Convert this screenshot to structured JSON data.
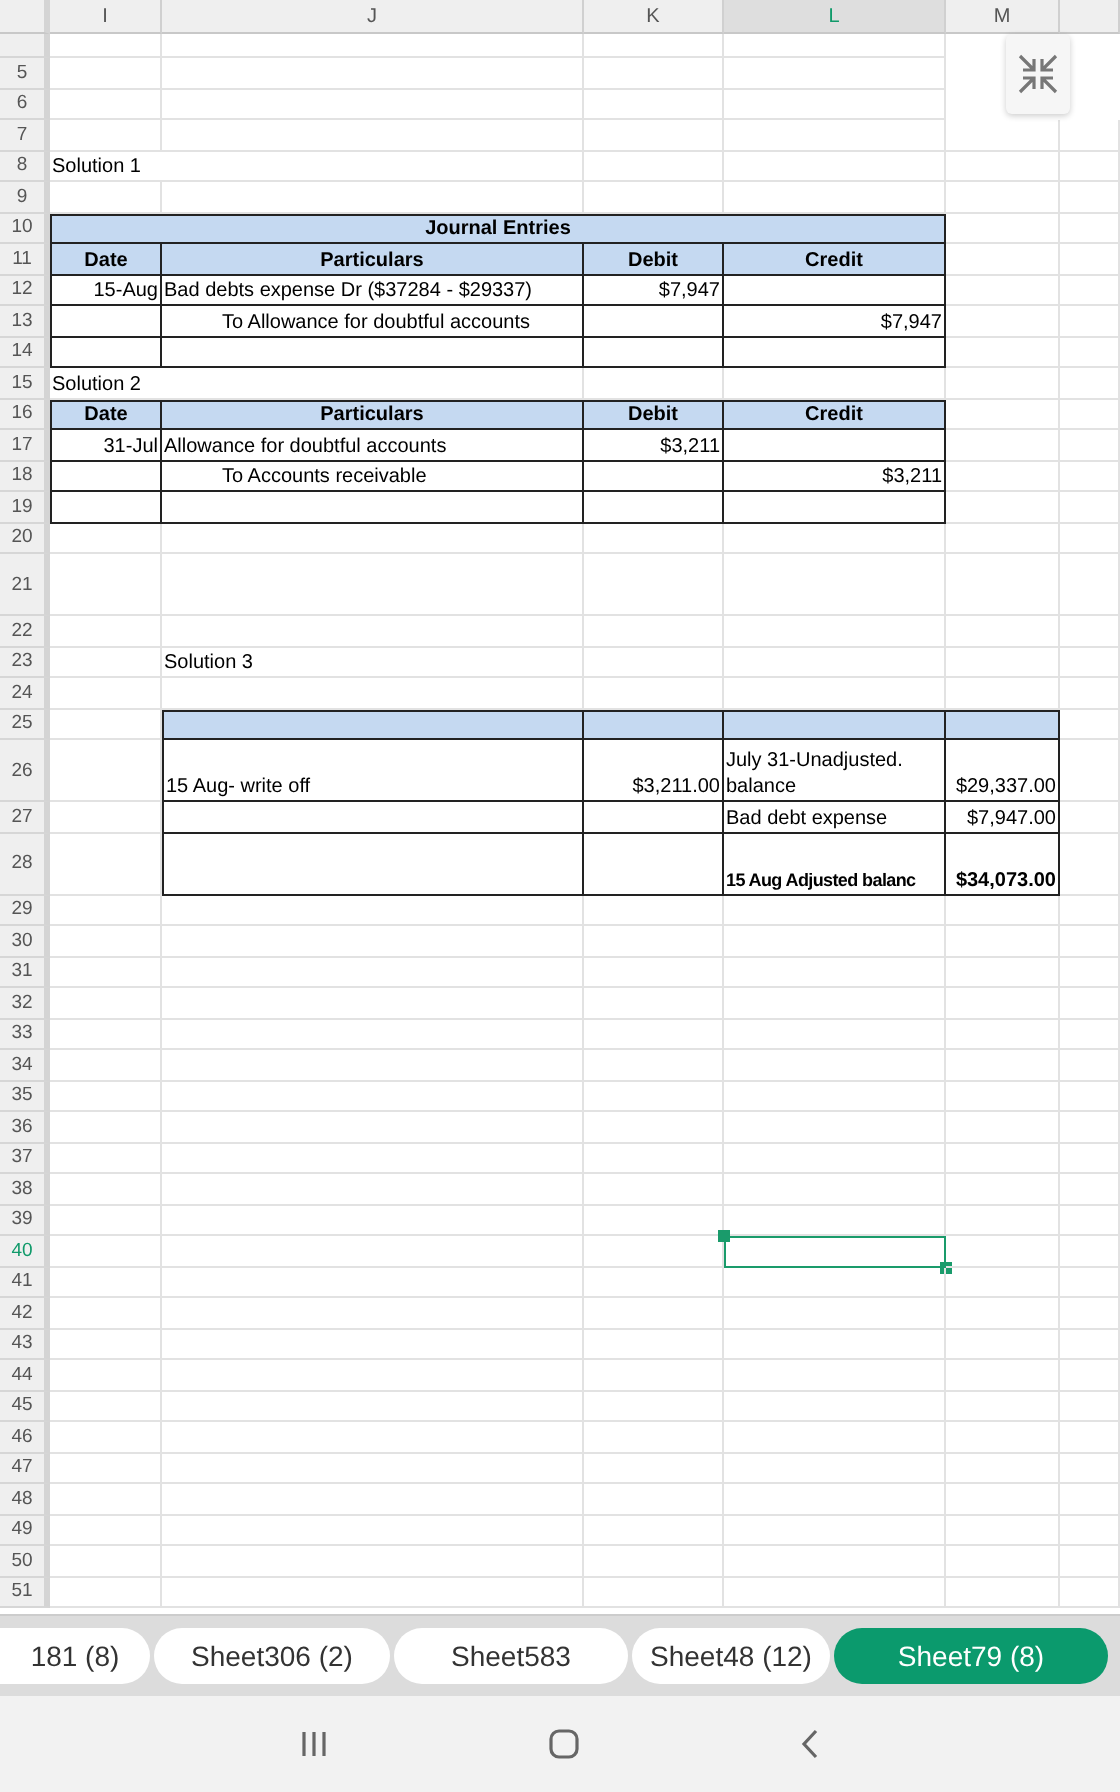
{
  "column_headers": [
    {
      "label": "I",
      "selected": false
    },
    {
      "label": "J",
      "selected": false
    },
    {
      "label": "K",
      "selected": false
    },
    {
      "label": "L",
      "selected": true
    },
    {
      "label": "M",
      "selected": false
    }
  ],
  "row_headers": [
    {
      "label": "5",
      "selected": false
    },
    {
      "label": "6",
      "selected": false
    },
    {
      "label": "7",
      "selected": false
    },
    {
      "label": "8",
      "selected": false
    },
    {
      "label": "9",
      "selected": false
    },
    {
      "label": "10",
      "selected": false
    },
    {
      "label": "11",
      "selected": false
    },
    {
      "label": "12",
      "selected": false
    },
    {
      "label": "13",
      "selected": false
    },
    {
      "label": "14",
      "selected": false
    },
    {
      "label": "15",
      "selected": false
    },
    {
      "label": "16",
      "selected": false
    },
    {
      "label": "17",
      "selected": false
    },
    {
      "label": "18",
      "selected": false
    },
    {
      "label": "19",
      "selected": false
    },
    {
      "label": "20",
      "selected": false
    },
    {
      "label": "21",
      "selected": false
    },
    {
      "label": "22",
      "selected": false
    },
    {
      "label": "23",
      "selected": false
    },
    {
      "label": "24",
      "selected": false
    },
    {
      "label": "25",
      "selected": false
    },
    {
      "label": "26",
      "selected": false
    },
    {
      "label": "27",
      "selected": false
    },
    {
      "label": "28",
      "selected": false
    },
    {
      "label": "29",
      "selected": false
    },
    {
      "label": "30",
      "selected": false
    },
    {
      "label": "31",
      "selected": false
    },
    {
      "label": "32",
      "selected": false
    },
    {
      "label": "33",
      "selected": false
    },
    {
      "label": "34",
      "selected": false
    },
    {
      "label": "35",
      "selected": false
    },
    {
      "label": "36",
      "selected": false
    },
    {
      "label": "37",
      "selected": false
    },
    {
      "label": "38",
      "selected": false
    },
    {
      "label": "39",
      "selected": false
    },
    {
      "label": "40",
      "selected": true
    },
    {
      "label": "41",
      "selected": false
    },
    {
      "label": "42",
      "selected": false
    },
    {
      "label": "43",
      "selected": false
    },
    {
      "label": "44",
      "selected": false
    },
    {
      "label": "45",
      "selected": false
    },
    {
      "label": "46",
      "selected": false
    },
    {
      "label": "47",
      "selected": false
    },
    {
      "label": "48",
      "selected": false
    },
    {
      "label": "49",
      "selected": false
    },
    {
      "label": "50",
      "selected": false
    },
    {
      "label": "51",
      "selected": false
    }
  ],
  "solution_1": "Solution 1",
  "journal_1": {
    "title": "Journal Entries",
    "headers": [
      "Date",
      "Particulars",
      "Debit",
      "Credit"
    ],
    "entries": [
      {
        "date": "15-Aug",
        "particulars": "Bad debts expense Dr ($37284 - $29337)",
        "debit": "$7,947",
        "kind": "debit"
      },
      {
        "particulars": "To Allowance for doubtful accounts",
        "credit": "$7,947",
        "kind": "credit"
      }
    ]
  },
  "solution_2": "Solution 2",
  "journal_2": {
    "headers": [
      "Date",
      "Particulars",
      "Debit",
      "Credit"
    ],
    "entries": [
      {
        "date": "31-Jul",
        "particulars": "Allowance for doubtful accounts",
        "debit": "$3,211",
        "kind": "debit"
      },
      {
        "particulars": "To Accounts receivable",
        "credit": "$3,211",
        "kind": "credit"
      }
    ]
  },
  "solution_3": "Solution 3",
  "balance_table": {
    "rows": [
      {
        "left_label": "15 Aug- write off",
        "left_amount": "$3,211.00",
        "right_label": "July 31-Unadjusted. balance",
        "right_amount": "$29,337.00",
        "kind": "normal"
      },
      {
        "right_label": "Bad debt expense",
        "right_amount": "$7,947.00",
        "kind": "normal"
      },
      {
        "right_label": "15 Aug Adjusted balanc",
        "right_amount": "$34,073.00",
        "kind": "total"
      }
    ]
  },
  "sheet_tabs": [
    {
      "label": "181 (8)",
      "selected": false
    },
    {
      "label": "Sheet306 (2)",
      "selected": false
    },
    {
      "label": "Sheet583",
      "selected": false
    },
    {
      "label": "Sheet48 (12)",
      "selected": false
    },
    {
      "label": "Sheet79 (8)",
      "selected": true
    }
  ]
}
